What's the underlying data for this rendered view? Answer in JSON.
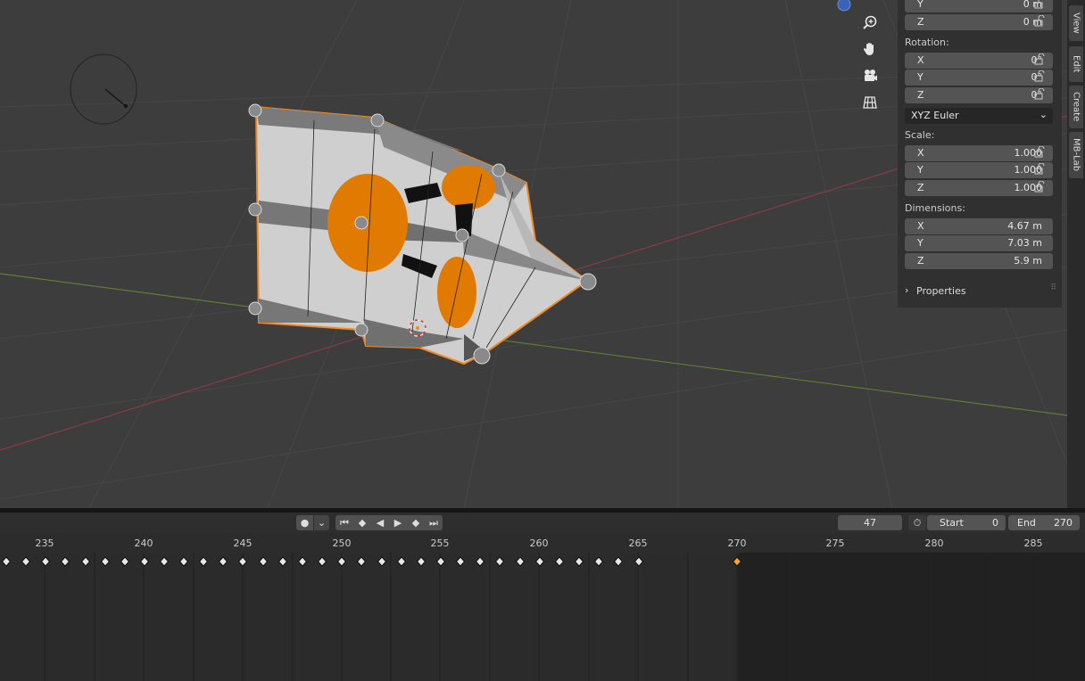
{
  "npanel": {
    "location": {
      "y": "0 m",
      "z": "0 m"
    },
    "rotation_label": "Rotation:",
    "rotation": {
      "x": "0°",
      "y": "0°",
      "z": "0°"
    },
    "rotation_mode": "XYZ Euler",
    "scale_label": "Scale:",
    "scale": {
      "x": "1.000",
      "y": "1.000",
      "z": "1.000"
    },
    "dimensions_label": "Dimensions:",
    "dimensions": {
      "x": "4.67 m",
      "y": "7.03 m",
      "z": "5.9 m"
    },
    "properties_label": "Properties",
    "axis_labels": {
      "x": "X",
      "y": "Y",
      "z": "Z"
    }
  },
  "side_tabs": [
    "View",
    "Edit",
    "Create",
    "MB-Lab"
  ],
  "timeline": {
    "current_frame": "47",
    "start_label": "Start",
    "start_value": "0",
    "end_label": "End",
    "end_value": "270",
    "ruler_ticks": [
      "235",
      "240",
      "245",
      "250",
      "255",
      "260",
      "265",
      "270",
      "275",
      "280",
      "285"
    ]
  },
  "colors": {
    "viewport_bg": "#3d3d3d",
    "selection_orange": "#f08a24",
    "keyframe": "#e8e8e8",
    "keyframe_selected": "#f5a623"
  }
}
